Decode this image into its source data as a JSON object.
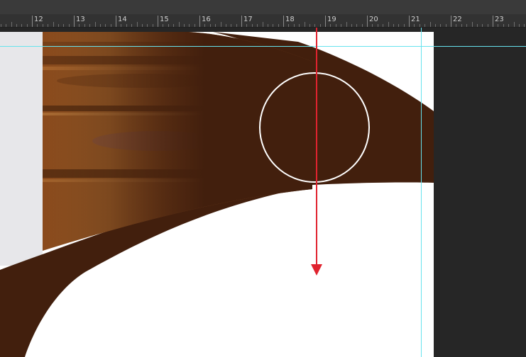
{
  "ruler": {
    "labels": [
      "12",
      "13",
      "14",
      "15",
      "16",
      "17",
      "18",
      "19",
      "20",
      "21",
      "22",
      "23"
    ]
  },
  "colors": {
    "pasteboard": "#262626",
    "ruler_bg": "#323232",
    "guide": "#67e3ee",
    "curve_brown": "#421f0d",
    "arrow": "#e0232f",
    "circle_stroke": "#ffffff",
    "paper": "#ffffff"
  },
  "canvas": {
    "photo": "wood-trim-photo",
    "selection_shape": "ellipse-selection",
    "drag_indicator": "red-arrow-down"
  }
}
